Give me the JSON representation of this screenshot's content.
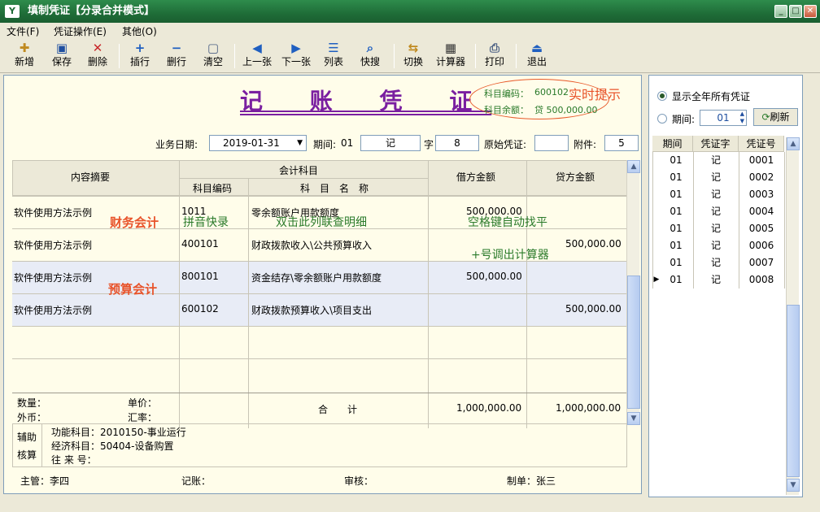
{
  "window": {
    "title": "填制凭证【分录合并模式】",
    "app_icon": "Y"
  },
  "menu": [
    {
      "label": "文件(F)"
    },
    {
      "label": "凭证操作(E)"
    },
    {
      "label": "其他(O)"
    }
  ],
  "toolbar": [
    {
      "label": "新增",
      "icon": "add-icon",
      "glyph": "✚"
    },
    {
      "label": "保存",
      "icon": "save-icon",
      "glyph": "▣"
    },
    {
      "label": "删除",
      "icon": "delete-icon",
      "glyph": "✕"
    },
    {
      "label": "插行",
      "icon": "insert-row-icon",
      "glyph": "+"
    },
    {
      "label": "删行",
      "icon": "delete-row-icon",
      "glyph": "−"
    },
    {
      "label": "清空",
      "icon": "clear-icon",
      "glyph": "▢"
    },
    {
      "label": "上一张",
      "icon": "prev-icon",
      "glyph": "◀"
    },
    {
      "label": "下一张",
      "icon": "next-icon",
      "glyph": "▶"
    },
    {
      "label": "列表",
      "icon": "list-icon",
      "glyph": "☰"
    },
    {
      "label": "快搜",
      "icon": "search-icon",
      "glyph": "⌕"
    },
    {
      "label": "切换",
      "icon": "switch-icon",
      "glyph": "⇆"
    },
    {
      "label": "计算器",
      "icon": "calculator-icon",
      "glyph": "▦"
    },
    {
      "label": "打印",
      "icon": "print-icon",
      "glyph": "⎙"
    },
    {
      "label": "退出",
      "icon": "exit-icon",
      "glyph": "⏏"
    }
  ],
  "voucher": {
    "title": "记 账 凭 证",
    "hint_code_label": "科目编码：",
    "hint_code_value": "600102",
    "hint_realtime": "实时提示",
    "hint_balance_label": "科目余额：",
    "hint_balance_value": "贷 500,000.00",
    "date_label": "业务日期:",
    "date_value": "2019-01-31",
    "period_label": "期间:",
    "period_value": "01",
    "word_value": "记",
    "word_label": "字",
    "number_value": "8",
    "original_label": "原始凭证:",
    "original_value": "",
    "attach_label": "附件:",
    "attach_value": "5",
    "col_summary": "内容摘要",
    "col_account": "会计科目",
    "col_code": "科目编码",
    "col_name": "科　目　名　称",
    "col_debit": "借方金额",
    "col_credit": "贷方金额",
    "rows": [
      {
        "summary": "软件使用方法示例",
        "code": "1011",
        "name": "零余额账户用款额度",
        "debit": "500,000.00",
        "credit": ""
      },
      {
        "summary": "软件使用方法示例",
        "code": "400101",
        "name": "财政拨款收入\\公共预算收入",
        "debit": "",
        "credit": "500,000.00"
      },
      {
        "summary": "软件使用方法示例",
        "code": "800101",
        "name": "资金结存\\零余额账户用款额度",
        "debit": "500,000.00",
        "credit": ""
      },
      {
        "summary": "软件使用方法示例",
        "code": "600102",
        "name": "财政拨款预算收入\\项目支出",
        "debit": "",
        "credit": "500,000.00"
      }
    ],
    "annot_finance": "财务会计",
    "annot_budget": "预算会计",
    "annot_pinyin": "拼音快录",
    "annot_dblclick": "双击此列联查明细",
    "annot_space": "空格键自动找平",
    "annot_plus": "+号调出计算器",
    "qty_label": "数量：",
    "price_label": "单价：",
    "currency_label": "外币：",
    "rate_label": "汇率：",
    "total_label": "合　　计",
    "total_debit": "1,000,000.00",
    "total_credit": "1,000,000.00",
    "aux_label1": "辅助",
    "aux_label2": "核算",
    "aux_func": "功能科目：2010150-事业运行",
    "aux_econ": "经济科目：50404-设备购置",
    "aux_contact": "往 来 号：",
    "footer_supervisor": "主管：李四",
    "footer_bookkeeping": "记账：",
    "footer_audit": "审核：",
    "footer_maker": "制单：张三"
  },
  "side": {
    "show_all_label": "显示全年所有凭证",
    "period_label": "期间:",
    "period_value": "01",
    "refresh_label": "刷新",
    "col_period": "期间",
    "col_word": "凭证字",
    "col_no": "凭证号",
    "rows": [
      {
        "period": "01",
        "word": "记",
        "no": "0001"
      },
      {
        "period": "01",
        "word": "记",
        "no": "0002"
      },
      {
        "period": "01",
        "word": "记",
        "no": "0003"
      },
      {
        "period": "01",
        "word": "记",
        "no": "0004"
      },
      {
        "period": "01",
        "word": "记",
        "no": "0005"
      },
      {
        "period": "01",
        "word": "记",
        "no": "0006"
      },
      {
        "period": "01",
        "word": "记",
        "no": "0007"
      },
      {
        "period": "01",
        "word": "记",
        "no": "0008"
      }
    ]
  }
}
